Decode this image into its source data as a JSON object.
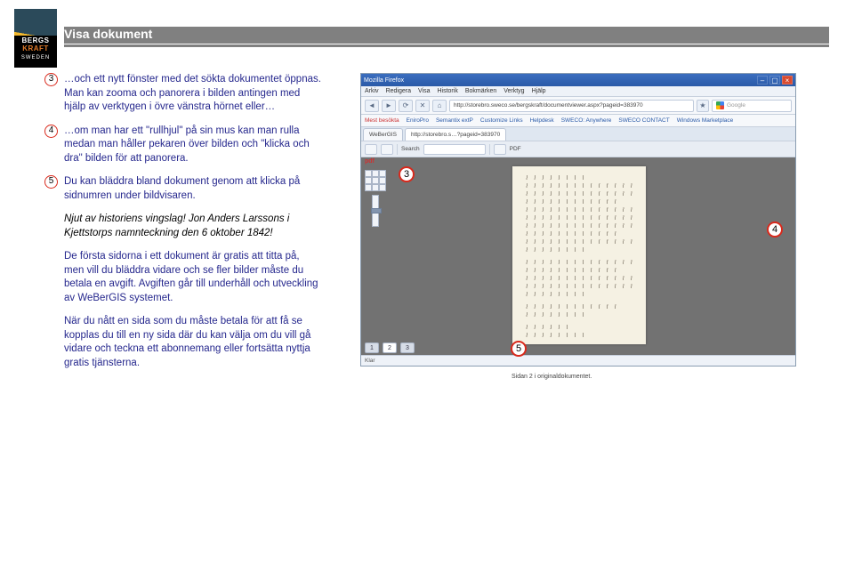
{
  "logo": {
    "line1": "BERGS",
    "line2": "KRAFT",
    "line3": "SWEDEN"
  },
  "title": "Visa dokument",
  "left": {
    "p3_badge": "3",
    "p3_a": "…och ett nytt fönster med det sökta dokumentet öppnas. Man kan zooma och panorera i bilden antingen med hjälp av verktygen i övre vänstra hörnet eller…",
    "p4_badge": "4",
    "p4_a": "…om man har ett \"rullhjul\" på sin mus kan man rulla medan man håller pekaren över bilden och \"klicka och dra\" bilden för att panorera.",
    "p5_badge": "5",
    "p5_a": "Du kan bläddra bland dokument genom att klicka på sidnumren under bildvisaren.",
    "italic": "Njut av historiens vingslag! Jon Anders Larssons i Kjettstorps namnteckning den 6 oktober 1842!",
    "p6": "De första sidorna i ett dokument är gratis att titta på, men vill du bläddra vidare och se fler bilder måste du betala en avgift. Avgiften går till underhåll och utveckling av WeBerGIS systemet.",
    "p7": "När du nått en sida som du måste betala för att få se kopplas du till en ny sida där du kan välja om du vill gå vidare och teckna ett abonnemang eller fortsätta nyttja gratis tjänsterna."
  },
  "browser": {
    "title": "Mozilla Firefox",
    "menu": [
      "Arkiv",
      "Redigera",
      "Visa",
      "Historik",
      "Bokmärken",
      "Verktyg",
      "Hjälp"
    ],
    "url": "http://storebro.sweco.se/bergskraft/documentviewer.aspx?pageid=383970",
    "search_placeholder": "Google",
    "bookmarks": [
      "Mest besökta",
      "EniroPro",
      "Semantix extP",
      "Customize Links",
      "Helpdesk",
      "SWECO: Anywhere",
      "SWECO CONTACT",
      "Windows Marketplace"
    ],
    "tab1": "WeBerGIS",
    "tab2": "http://storebro.s…?pageid=383970",
    "toolbar_search": "Search",
    "toolbar_label2": "PDF",
    "pdf_label": "pdf",
    "pager": [
      "1",
      "2",
      "3"
    ],
    "caption": "Sidan 2 i originaldokumentet.",
    "status": "Klar"
  },
  "callouts": {
    "c3": "3",
    "c4": "4",
    "c5": "5"
  }
}
